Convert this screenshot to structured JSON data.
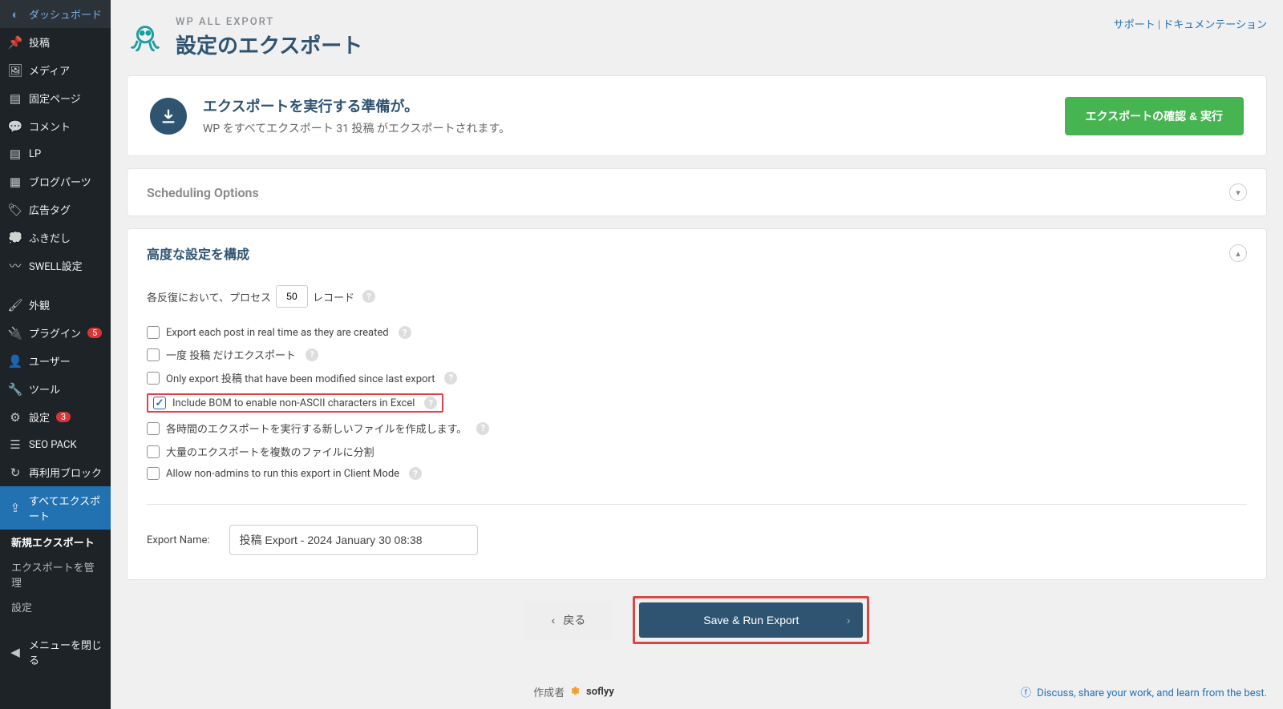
{
  "sidebar": {
    "items": [
      {
        "icon": "dashboard",
        "label": "ダッシュボード"
      },
      {
        "icon": "pin",
        "label": "投稿"
      },
      {
        "icon": "media",
        "label": "メディア"
      },
      {
        "icon": "page",
        "label": "固定ページ"
      },
      {
        "icon": "comment",
        "label": "コメント"
      },
      {
        "icon": "page",
        "label": "LP"
      },
      {
        "icon": "grid",
        "label": "ブログパーツ"
      },
      {
        "icon": "tag",
        "label": "広告タグ"
      },
      {
        "icon": "bubble",
        "label": "ふきだし"
      },
      {
        "icon": "swell",
        "label": "SWELL設定"
      },
      {
        "icon": "brush",
        "label": "外観"
      },
      {
        "icon": "plugin",
        "label": "プラグイン",
        "badge": "5"
      },
      {
        "icon": "user",
        "label": "ユーザー"
      },
      {
        "icon": "tool",
        "label": "ツール"
      },
      {
        "icon": "settings",
        "label": "設定",
        "badge": "3"
      },
      {
        "icon": "seo",
        "label": "SEO PACK"
      },
      {
        "icon": "reuse",
        "label": "再利用ブロック"
      },
      {
        "icon": "export",
        "label": "すべてエクスポート",
        "active": true
      }
    ],
    "sub": [
      {
        "label": "新規エクスポート",
        "active": true
      },
      {
        "label": "エクスポートを管理"
      },
      {
        "label": "設定"
      }
    ],
    "collapse": "メニューを閉じる"
  },
  "header": {
    "sup": "WP ALL EXPORT",
    "title": "設定のエクスポート",
    "link_support": "サポート",
    "sep": " | ",
    "link_docs": "ドキュメンテーション"
  },
  "ready": {
    "title": "エクスポートを実行する準備が。",
    "desc": "WP をすべてエクスポート 31 投稿 がエクスポートされます。",
    "cta": "エクスポートの確認 & 実行"
  },
  "scheduling": {
    "title": "Scheduling Options"
  },
  "advanced": {
    "title": "高度な設定を構成",
    "iter_pre": "各反復において、プロセス",
    "iter_val": "50",
    "iter_post": "レコード",
    "opts": [
      {
        "label": "Export each post in real time as they are created",
        "checked": false,
        "help": true
      },
      {
        "label": "一度 投稿 だけエクスポート",
        "checked": false,
        "help": true
      },
      {
        "label": "Only export 投稿 that have been modified since last export",
        "checked": false,
        "help": true
      },
      {
        "label": "Include BOM to enable non-ASCII characters in Excel",
        "checked": true,
        "help": true,
        "highlight": true
      },
      {
        "label": "各時間のエクスポートを実行する新しいファイルを作成します。",
        "checked": false,
        "help": true
      },
      {
        "label": "大量のエクスポートを複数のファイルに分割",
        "checked": false
      },
      {
        "label": "Allow non-admins to run this export in Client Mode",
        "checked": false,
        "help": true
      }
    ],
    "name_label": "Export Name:",
    "name_value": "投稿 Export - 2024 January 30 08:38"
  },
  "nav": {
    "back": "戻る",
    "save": "Save & Run Export"
  },
  "footer": {
    "creator": "作成者",
    "brand": "soflyy",
    "discuss": "Discuss, share your work, and learn from the best."
  }
}
